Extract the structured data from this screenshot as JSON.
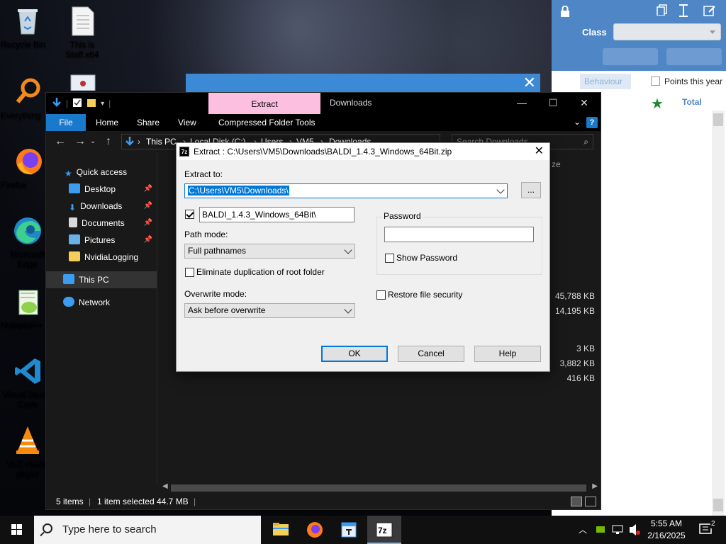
{
  "desktop": {
    "icons": [
      {
        "label": "Recycle Bin"
      },
      {
        "label": "This is Staff.x64"
      },
      {
        "label": "Everything"
      },
      {
        "label": "Firefox"
      },
      {
        "label": "Microsoft Edge"
      },
      {
        "label": "Notepad++"
      },
      {
        "label": "Visual Studio Code"
      },
      {
        "label": "VLC media player"
      }
    ]
  },
  "app_panel": {
    "class_label": "Class",
    "class_value": "",
    "tabs": {
      "behaviour": "Behaviour",
      "points": "Points this year"
    },
    "total_label": "Total"
  },
  "explorer": {
    "tab_extract": "Extract",
    "title": "Downloads",
    "ribbon": [
      "File",
      "Home",
      "Share",
      "View",
      "Compressed Folder Tools"
    ],
    "address": [
      "This PC",
      "Local Disk (C:)",
      "Users",
      "VM5",
      "Downloads"
    ],
    "search_placeholder": "Search Downloads",
    "nav": [
      {
        "label": "Quick access",
        "icon": "star-icon"
      },
      {
        "label": "Desktop",
        "icon": "desktop-icon"
      },
      {
        "label": "Downloads",
        "icon": "download-icon"
      },
      {
        "label": "Documents",
        "icon": "document-icon"
      },
      {
        "label": "Pictures",
        "icon": "pictures-icon"
      },
      {
        "label": "NvidiaLogging",
        "icon": "folder-icon"
      },
      {
        "label": "This PC",
        "icon": "computer-icon"
      },
      {
        "label": "Network",
        "icon": "network-icon"
      }
    ],
    "size_header": "ze",
    "sizes": [
      "45,788 KB",
      "14,195 KB",
      "3 KB",
      "3,882 KB",
      "416 KB"
    ],
    "status": {
      "items": "5 items",
      "selected": "1 item selected",
      "size": "44.7 MB"
    }
  },
  "dialog": {
    "title": "Extract : C:\\Users\\VM5\\Downloads\\BALDI_1.4.3_Windows_64Bit.zip",
    "extract_to_label": "Extract to:",
    "extract_to_value": "C:\\Users\\VM5\\Downloads\\",
    "browse_label": "...",
    "folder_name": "BALDI_1.4.3_Windows_64Bit\\",
    "path_mode_label": "Path mode:",
    "path_mode_value": "Full pathnames",
    "eliminate_label": "Eliminate duplication of root folder",
    "overwrite_label": "Overwrite mode:",
    "overwrite_value": "Ask before overwrite",
    "password_label": "Password",
    "show_password_label": "Show Password",
    "restore_label": "Restore file security",
    "ok": "OK",
    "cancel": "Cancel",
    "help": "Help"
  },
  "taskbar": {
    "search_placeholder": "Type here to search",
    "time": "5:55 AM",
    "date": "2/16/2025",
    "notification_count": "2"
  }
}
